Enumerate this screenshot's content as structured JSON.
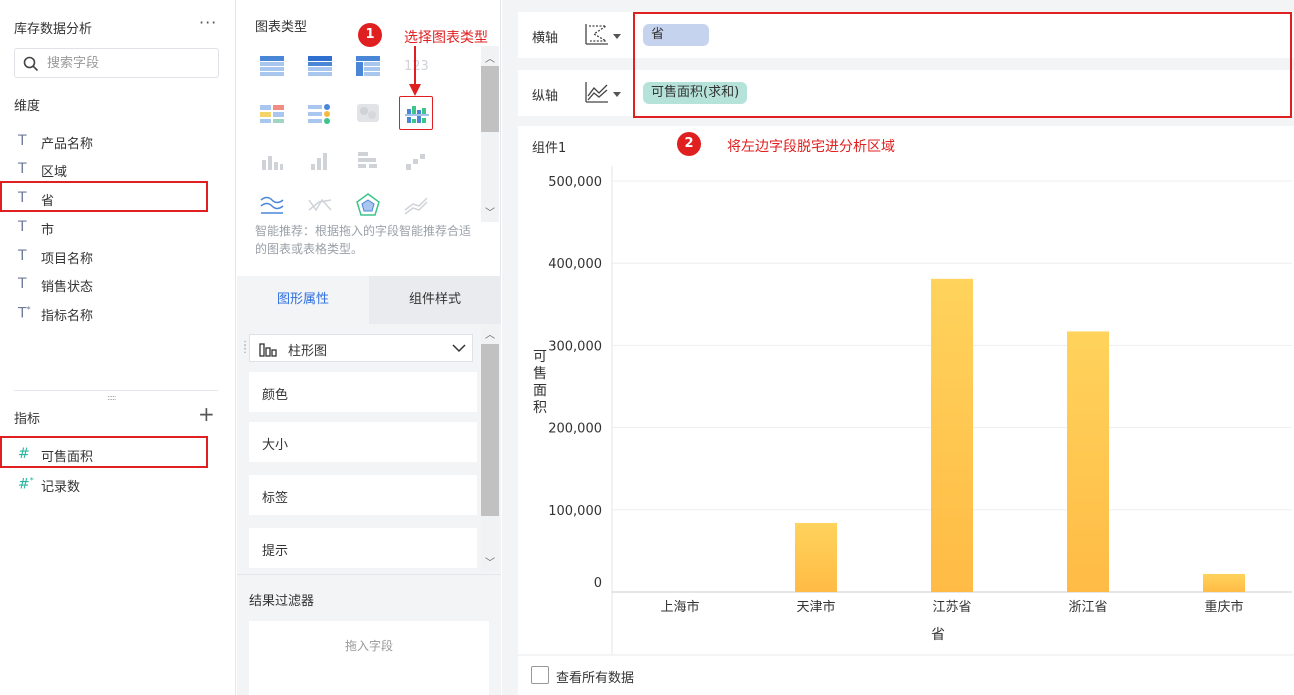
{
  "left_panel": {
    "title": "库存数据分析",
    "more_icon": "···",
    "search": {
      "placeholder": "搜索字段",
      "value": ""
    },
    "dimensions_title": "维度",
    "dimensions": [
      {
        "icon": "T",
        "label": "产品名称"
      },
      {
        "icon": "T",
        "label": "区域"
      },
      {
        "icon": "T",
        "label": "省"
      },
      {
        "icon": "T",
        "label": "市"
      },
      {
        "icon": "T",
        "label": "项目名称"
      },
      {
        "icon": "T",
        "label": "销售状态"
      },
      {
        "icon": "T",
        "label": "指标名称"
      }
    ],
    "metrics_title": "指标",
    "metrics": [
      {
        "icon": "#",
        "label": "可售面积"
      },
      {
        "icon": "#",
        "label": "记录数"
      }
    ]
  },
  "middle_panel": {
    "chart_type_title": "图表类型",
    "smart_tip": "智能推荐：根据拖入的字段智能推荐合适的图表或表格类型。",
    "tabs": [
      {
        "label": "图形属性"
      },
      {
        "label": "组件样式"
      }
    ],
    "chart_type_select": "柱形图",
    "properties": [
      {
        "label": "颜色"
      },
      {
        "label": "大小"
      },
      {
        "label": "标签"
      },
      {
        "label": "提示"
      }
    ],
    "filter_title": "结果过滤器",
    "filter_placeholder": "拖入字段"
  },
  "right_panel": {
    "x_axis_label": "横轴",
    "x_axis_field": "省",
    "y_axis_label": "纵轴",
    "y_axis_field": "可售面积(求和)",
    "card_title": "组件1",
    "view_all_label": "查看所有数据"
  },
  "annotations": {
    "step1_number": "1",
    "step1_text": "选择图表类型",
    "step2_number": "2",
    "step2_text": "将左边字段脱宅进分析区域"
  },
  "colors": {
    "bar_top": "#ffd35c",
    "bar_bottom": "#ffbb45",
    "annotation_red": "#e02020",
    "dimension_pill": "#c5d3ee",
    "measure_pill": "#b5e3d9",
    "accent_blue": "#2d6ee0"
  },
  "chart_data": {
    "type": "bar",
    "categories": [
      "上海市",
      "天津市",
      "江苏省",
      "浙江省",
      "重庆市"
    ],
    "values": [
      0,
      84000,
      381000,
      317000,
      22000
    ],
    "y_ticks": [
      "0",
      "100,000",
      "200,000",
      "300,000",
      "400,000",
      "500,000"
    ],
    "xlabel": "省",
    "ylabel": "可售面积",
    "ylim": [
      0,
      500000
    ],
    "grid": true
  }
}
